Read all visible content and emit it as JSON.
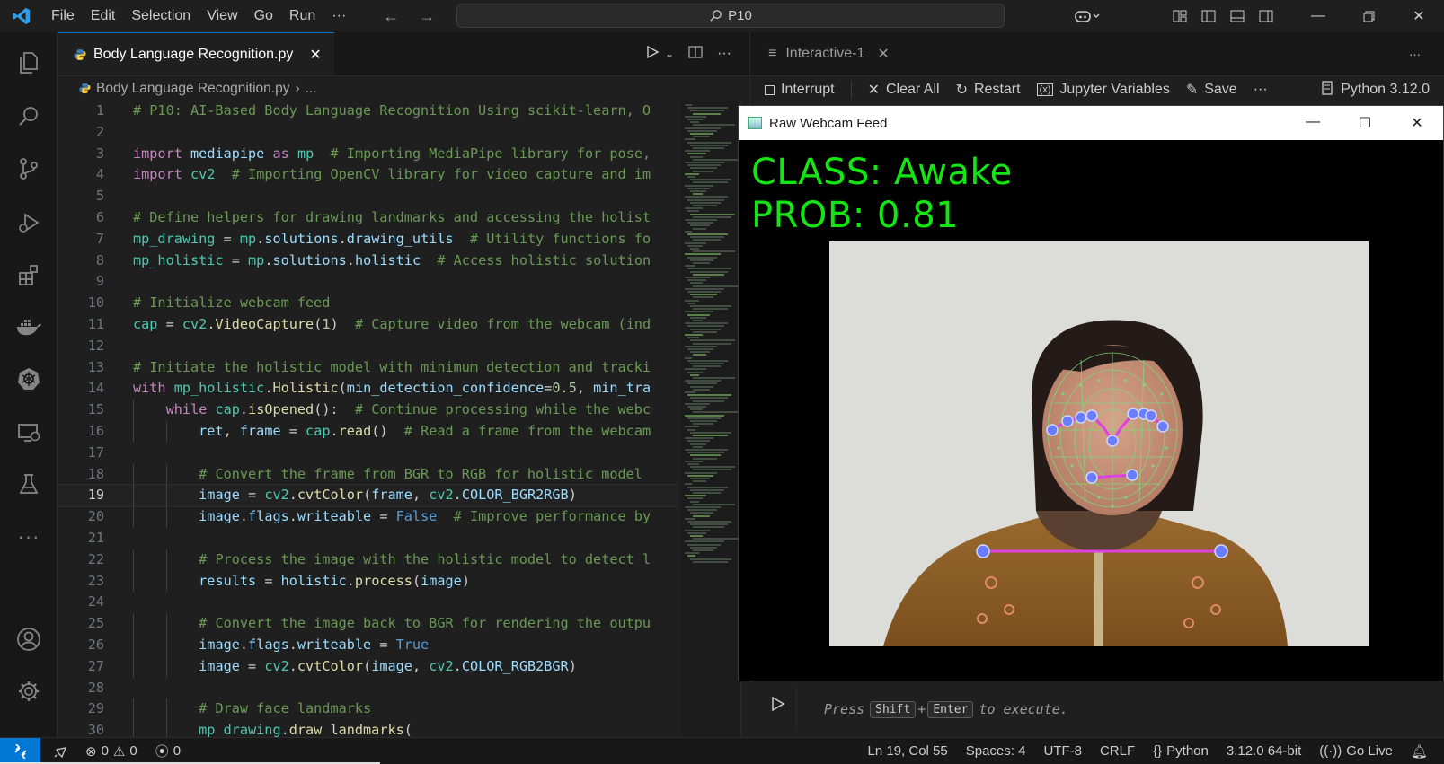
{
  "menu": [
    "File",
    "Edit",
    "Selection",
    "View",
    "Go",
    "Run",
    "···"
  ],
  "search": {
    "text": "P10"
  },
  "editor": {
    "tab_label": "Body Language Recognition.py",
    "breadcrumb_file": "Body Language Recognition.py",
    "breadcrumb_rest": "...",
    "current_line": 19
  },
  "code_lines": [
    "# P10: AI-Based Body Language Recognition Using scikit-learn, O",
    "",
    "import mediapipe as mp  # Importing MediaPipe library for pose,",
    "import cv2  # Importing OpenCV library for video capture and im",
    "",
    "# Define helpers for drawing landmarks and accessing the holist",
    "mp_drawing = mp.solutions.drawing_utils  # Utility functions fo",
    "mp_holistic = mp.solutions.holistic  # Access holistic solution",
    "",
    "# Initialize webcam feed",
    "cap = cv2.VideoCapture(1)  # Capture video from the webcam (ind",
    "",
    "# Initiate the holistic model with minimum detection and tracki",
    "with mp_holistic.Holistic(min_detection_confidence=0.5, min_tra",
    "    while cap.isOpened():  # Continue processing while the webc",
    "        ret, frame = cap.read()  # Read a frame from the webcam",
    "",
    "        # Convert the frame from BGR to RGB for holistic model",
    "        image = cv2.cvtColor(frame, cv2.COLOR_BGR2RGB)",
    "        image.flags.writeable = False  # Improve performance by",
    "",
    "        # Process the image with the holistic model to detect l",
    "        results = holistic.process(image)",
    "",
    "        # Convert the image back to BGR for rendering the outpu",
    "        image.flags.writeable = True",
    "        image = cv2.cvtColor(image, cv2.COLOR_RGB2BGR)",
    "",
    "        # Draw face landmarks",
    "        mp_drawing.draw_landmarks("
  ],
  "panel": {
    "tab_label": "Interactive-1",
    "toolbar": {
      "interrupt": "Interrupt",
      "clear_all": "Clear All",
      "restart": "Restart",
      "variables": "Jupyter Variables",
      "save": "Save",
      "more": "···",
      "kernel": "Python 3.12.0"
    },
    "input_hint_pre": "Press",
    "key1": "Shift",
    "plus": "+",
    "key2": "Enter",
    "input_hint_post": "to execute."
  },
  "webcam": {
    "window_title": "Raw Webcam Feed",
    "class_text": "CLASS: Awake",
    "prob_text": "PROB: 0.81"
  },
  "status": {
    "errors": "0",
    "warnings": "0",
    "ports": "0",
    "position": "Ln 19, Col 55",
    "spaces": "Spaces: 4",
    "encoding": "UTF-8",
    "eol": "CRLF",
    "language": "Python",
    "interpreter": "3.12.0 64-bit",
    "live": "Go Live"
  },
  "colors": {
    "accent": "#0078d4",
    "overlay_text": "#14e614",
    "landmark_line": "#e040e0",
    "landmark_point": "#6a7cff",
    "mesh": "#7ddc7d"
  }
}
